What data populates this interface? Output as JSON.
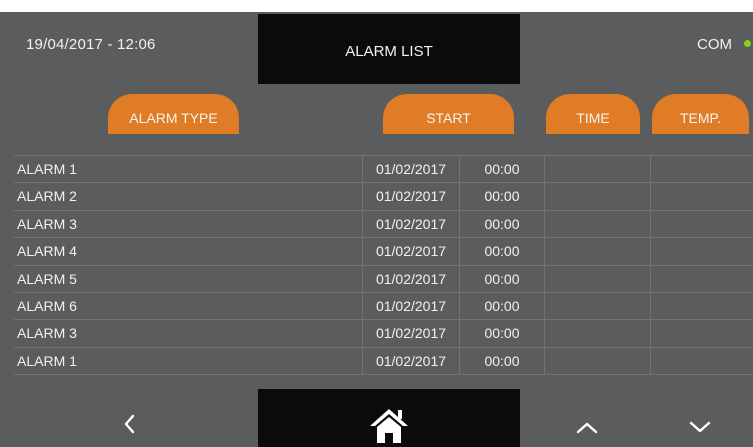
{
  "header": {
    "datetime": "19/04/2017 - 12:06",
    "title": "ALARM LIST",
    "com_label": "COM",
    "com_status_color": "#7ed321"
  },
  "columns": {
    "alarm_type": "ALARM TYPE",
    "start": "START",
    "time": "TIME",
    "temp": "TEMP."
  },
  "rows": [
    {
      "name": "ALARM 1",
      "date": "01/02/2017",
      "time": "00:00",
      "duration": "",
      "temp": ""
    },
    {
      "name": "ALARM 2",
      "date": "01/02/2017",
      "time": "00:00",
      "duration": "",
      "temp": ""
    },
    {
      "name": "ALARM 3",
      "date": "01/02/2017",
      "time": "00:00",
      "duration": "",
      "temp": ""
    },
    {
      "name": "ALARM 4",
      "date": "01/02/2017",
      "time": "00:00",
      "duration": "",
      "temp": ""
    },
    {
      "name": "ALARM 5",
      "date": "01/02/2017",
      "time": "00:00",
      "duration": "",
      "temp": ""
    },
    {
      "name": "ALARM 6",
      "date": "01/02/2017",
      "time": "00:00",
      "duration": "",
      "temp": ""
    },
    {
      "name": "ALARM 3",
      "date": "01/02/2017",
      "time": "00:00",
      "duration": "",
      "temp": ""
    },
    {
      "name": "ALARM 1",
      "date": "01/02/2017",
      "time": "00:00",
      "duration": "",
      "temp": ""
    }
  ],
  "nav": {
    "back_icon": "chevron-left-icon",
    "home_icon": "home-icon",
    "up_icon": "chevron-up-icon",
    "down_icon": "chevron-down-icon"
  },
  "colors": {
    "background": "#5b5c5e",
    "accent": "#e07c25",
    "panel": "#0b0b0b",
    "text": "#f2f2f2"
  }
}
